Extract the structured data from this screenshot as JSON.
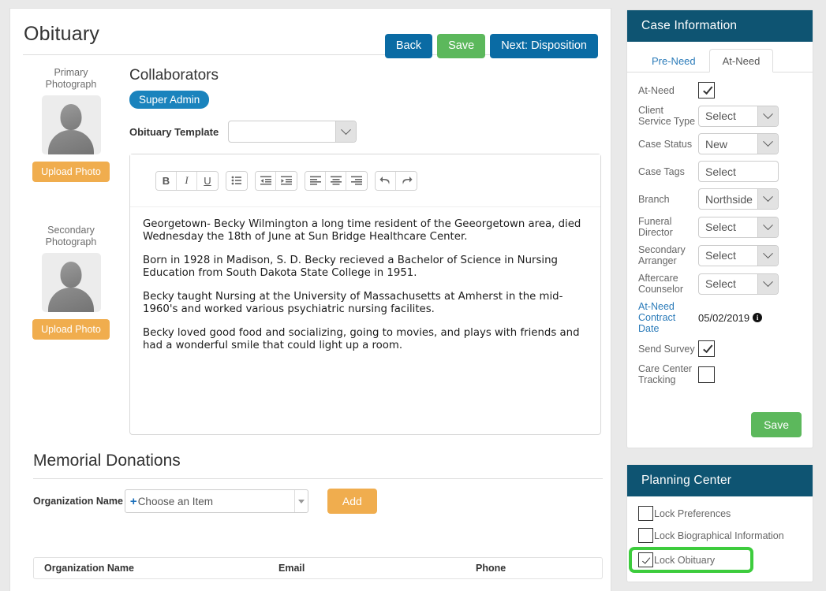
{
  "page": {
    "title": "Obituary"
  },
  "toolbar": {
    "back_label": "Back",
    "save_label": "Save",
    "next_label": "Next: Disposition"
  },
  "photos": {
    "primary": {
      "label_line1": "Primary",
      "label_line2": "Photograph",
      "upload_label": "Upload Photo"
    },
    "secondary": {
      "label_line1": "Secondary",
      "label_line2": "Photograph",
      "upload_label": "Upload Photo"
    }
  },
  "collaborators": {
    "heading": "Collaborators",
    "badges": [
      "Super Admin"
    ]
  },
  "obituary_template": {
    "label": "Obituary Template",
    "value": "",
    "placeholder": ""
  },
  "editor": {
    "toolbar_buttons": [
      "bold-icon",
      "italic-icon",
      "underline-icon",
      "bullet-list-icon",
      "outdent-icon",
      "indent-icon",
      "align-left-icon",
      "align-center-icon",
      "align-right-icon",
      "undo-icon",
      "redo-icon"
    ],
    "paragraphs": [
      "Georgetown- Becky Wilmington a long time resident of the Geeorgetown area, died Wednesday the 18th of June at Sun Bridge Healthcare Center.",
      "Born in 1928 in Madison, S. D. Becky recieved a Bachelor of Science in Nursing Education from South Dakota State College in 1951.",
      "Becky taught Nursing at the University of Massachusetts at Amherst in the mid-1960's and worked various psychiatric nursing facilites.",
      "Becky loved good food and socializing, going to movies, and plays with friends and had a wonderful smile that could light up a room."
    ]
  },
  "memorial_donations": {
    "heading": "Memorial Donations",
    "org_label": "Organization Name",
    "org_value": "Choose an Item",
    "add_label": "Add",
    "table_headers": [
      "Organization Name",
      "Email",
      "Phone"
    ],
    "rows": []
  },
  "case_information": {
    "header": "Case Information",
    "tabs": [
      {
        "label": "Pre-Need",
        "active": false
      },
      {
        "label": "At-Need",
        "active": true
      }
    ],
    "fields": [
      {
        "label": "At-Need",
        "type": "checkbox",
        "checked": true
      },
      {
        "label": "Client Service Type",
        "type": "select",
        "value": "Select"
      },
      {
        "label": "Case Status",
        "type": "select",
        "value": "New"
      },
      {
        "label": "Case Tags",
        "type": "text",
        "value": "Select"
      },
      {
        "label": "Branch",
        "type": "select",
        "value": "Northside"
      },
      {
        "label": "Funeral Director",
        "type": "select",
        "value": "Select"
      },
      {
        "label": "Secondary Arranger",
        "type": "select",
        "value": "Select"
      },
      {
        "label": "Aftercare Counselor",
        "type": "select",
        "value": "Select"
      },
      {
        "label": "At-Need Contract Date",
        "type": "date",
        "value": "05/02/2019",
        "link": true,
        "info": "i"
      },
      {
        "label": "Send Survey",
        "type": "checkbox",
        "checked": true
      },
      {
        "label": "Care Center Tracking",
        "type": "checkbox",
        "checked": false
      }
    ],
    "save_label": "Save"
  },
  "planning_center": {
    "header": "Planning Center",
    "items": [
      {
        "label": "Lock Preferences",
        "checked": false,
        "highlighted": false
      },
      {
        "label": "Lock Biographical Information",
        "checked": false,
        "highlighted": false
      },
      {
        "label": "Lock Obituary",
        "checked": true,
        "highlighted": true
      }
    ]
  },
  "colors": {
    "panel_header": "#0e5472",
    "primary_blue": "#0a6ba4",
    "badge_blue": "#1a83bd",
    "green": "#5cb85c",
    "orange": "#f0ad4e",
    "highlight_green": "#3dcc3d",
    "link_blue": "#2b7bb9"
  }
}
